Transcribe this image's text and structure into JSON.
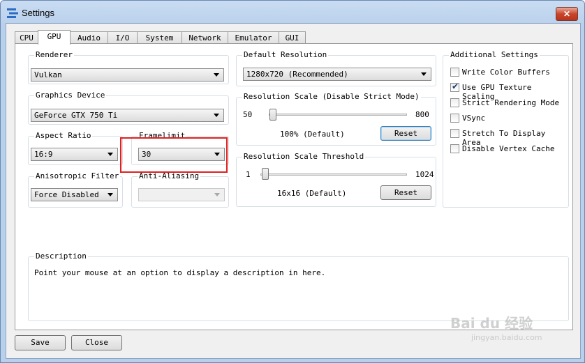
{
  "window": {
    "title": "Settings",
    "close_glyph": "✕",
    "icon": "app-logo-icon"
  },
  "tabs": [
    "CPU",
    "GPU",
    "Audio",
    "I/O",
    "System",
    "Network",
    "Emulator",
    "GUI"
  ],
  "active_tab": "GPU",
  "renderer": {
    "label": "Renderer",
    "value": "Vulkan"
  },
  "graphics_device": {
    "label": "Graphics Device",
    "value": "GeForce GTX 750 Ti"
  },
  "aspect_ratio": {
    "label": "Aspect Ratio",
    "value": "16:9"
  },
  "framelimit": {
    "label": "Framelimit",
    "value": "30"
  },
  "anisotropic": {
    "label": "Anisotropic Filter",
    "value": "Force Disabled"
  },
  "anti_aliasing": {
    "label": "Anti-Aliasing",
    "value": ""
  },
  "default_resolution": {
    "label": "Default Resolution",
    "value": "1280x720 (Recommended)"
  },
  "resolution_scale": {
    "label": "Resolution Scale (Disable Strict Mode)",
    "min": "50",
    "max": "800",
    "status": "100% (Default)",
    "reset": "Reset",
    "level": 100
  },
  "resolution_threshold": {
    "label": "Resolution Scale Threshold",
    "min": "1",
    "max": "1024",
    "status": "16x16 (Default)",
    "reset": "Reset",
    "level": 16
  },
  "additional": {
    "label": "Additional Settings",
    "options": [
      {
        "label": "Write Color Buffers",
        "checked": false
      },
      {
        "label": "Use GPU Texture Scaling",
        "checked": true
      },
      {
        "label": "Strict Rendering Mode",
        "checked": false
      },
      {
        "label": "VSync",
        "checked": false
      },
      {
        "label": "Stretch To Display Area",
        "checked": false
      },
      {
        "label": "Disable Vertex Cache",
        "checked": false
      }
    ]
  },
  "description": {
    "label": "Description",
    "text": "Point your mouse at an option to display a description in here."
  },
  "footer": {
    "save": "Save",
    "close": "Close"
  },
  "watermark": {
    "brand": "Bai du 经验",
    "url": "jingyan.baidu.com"
  },
  "colors": {
    "highlight": "#e02020",
    "window_frame": "#b9d0ec"
  }
}
